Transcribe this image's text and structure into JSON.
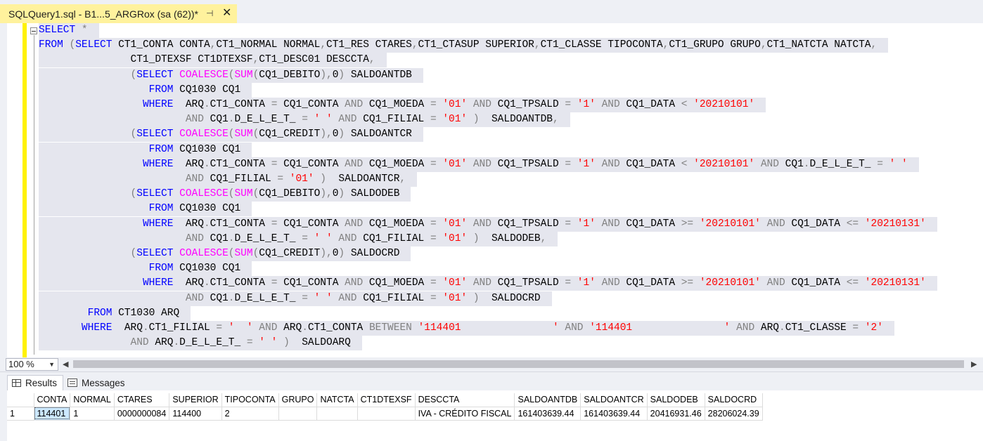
{
  "tab": {
    "title": "SQLQuery1.sql - B1...5_ARGRox (sa (62))*",
    "pin_icon": "pin-icon",
    "close_icon": "close-icon"
  },
  "editor": {
    "lines": [
      [
        [
          "kw",
          "SELECT"
        ],
        [
          "tx",
          " "
        ],
        [
          "op",
          "*"
        ]
      ],
      [
        [
          "kw",
          "FROM"
        ],
        [
          "tx",
          " "
        ],
        [
          "op",
          "("
        ],
        [
          "kw",
          "SELECT"
        ],
        [
          "tx",
          " CT1_CONTA CONTA"
        ],
        [
          "op",
          ","
        ],
        [
          "tx",
          "CT1_NORMAL NORMAL"
        ],
        [
          "op",
          ","
        ],
        [
          "tx",
          "CT1_RES CTARES"
        ],
        [
          "op",
          ","
        ],
        [
          "tx",
          "CT1_CTASUP SUPERIOR"
        ],
        [
          "op",
          ","
        ],
        [
          "tx",
          "CT1_CLASSE TIPOCONTA"
        ],
        [
          "op",
          ","
        ],
        [
          "tx",
          "CT1_GRUPO GRUPO"
        ],
        [
          "op",
          ","
        ],
        [
          "tx",
          "CT1_NATCTA NATCTA"
        ],
        [
          "op",
          ","
        ]
      ],
      [
        [
          "tx",
          "               CT1_DTEXSF CT1DTEXSF"
        ],
        [
          "op",
          ","
        ],
        [
          "tx",
          "CT1_DESC01 DESCCTA"
        ],
        [
          "op",
          ","
        ]
      ],
      [
        [
          "tx",
          "               "
        ],
        [
          "op",
          "("
        ],
        [
          "kw",
          "SELECT"
        ],
        [
          "tx",
          " "
        ],
        [
          "fn",
          "COALESCE"
        ],
        [
          "op",
          "("
        ],
        [
          "fn",
          "SUM"
        ],
        [
          "op",
          "("
        ],
        [
          "tx",
          "CQ1_DEBITO"
        ],
        [
          "op",
          "),"
        ],
        [
          "tx",
          "0"
        ],
        [
          "op",
          ")"
        ],
        [
          "tx",
          " SALDOANTDB"
        ]
      ],
      [
        [
          "tx",
          "                  "
        ],
        [
          "kw",
          "FROM"
        ],
        [
          "tx",
          " CQ1030 CQ1"
        ]
      ],
      [
        [
          "tx",
          "                 "
        ],
        [
          "kw",
          "WHERE"
        ],
        [
          "tx",
          "  ARQ"
        ],
        [
          "op",
          "."
        ],
        [
          "tx",
          "CT1_CONTA "
        ],
        [
          "op",
          "="
        ],
        [
          "tx",
          " CQ1_CONTA "
        ],
        [
          "op",
          "AND"
        ],
        [
          "tx",
          " CQ1_MOEDA "
        ],
        [
          "op",
          "="
        ],
        [
          "tx",
          " "
        ],
        [
          "str",
          "'01'"
        ],
        [
          "tx",
          " "
        ],
        [
          "op",
          "AND"
        ],
        [
          "tx",
          " CQ1_TPSALD "
        ],
        [
          "op",
          "="
        ],
        [
          "tx",
          " "
        ],
        [
          "str",
          "'1'"
        ],
        [
          "tx",
          " "
        ],
        [
          "op",
          "AND"
        ],
        [
          "tx",
          " CQ1_DATA "
        ],
        [
          "op",
          "<"
        ],
        [
          "tx",
          " "
        ],
        [
          "str",
          "'20210101'"
        ]
      ],
      [
        [
          "tx",
          "                        "
        ],
        [
          "op",
          "AND"
        ],
        [
          "tx",
          " CQ1"
        ],
        [
          "op",
          "."
        ],
        [
          "tx",
          "D_E_L_E_T_ "
        ],
        [
          "op",
          "="
        ],
        [
          "tx",
          " "
        ],
        [
          "str",
          "' '"
        ],
        [
          "tx",
          " "
        ],
        [
          "op",
          "AND"
        ],
        [
          "tx",
          " CQ1_FILIAL "
        ],
        [
          "op",
          "="
        ],
        [
          "tx",
          " "
        ],
        [
          "str",
          "'01'"
        ],
        [
          "tx",
          " "
        ],
        [
          "op",
          ")"
        ],
        [
          "tx",
          "  SALDOANTDB"
        ],
        [
          "op",
          ","
        ]
      ],
      [
        [
          "tx",
          "               "
        ],
        [
          "op",
          "("
        ],
        [
          "kw",
          "SELECT"
        ],
        [
          "tx",
          " "
        ],
        [
          "fn",
          "COALESCE"
        ],
        [
          "op",
          "("
        ],
        [
          "fn",
          "SUM"
        ],
        [
          "op",
          "("
        ],
        [
          "tx",
          "CQ1_CREDIT"
        ],
        [
          "op",
          "),"
        ],
        [
          "tx",
          "0"
        ],
        [
          "op",
          ")"
        ],
        [
          "tx",
          " SALDOANTCR"
        ]
      ],
      [
        [
          "tx",
          "                  "
        ],
        [
          "kw",
          "FROM"
        ],
        [
          "tx",
          " CQ1030 CQ1"
        ]
      ],
      [
        [
          "tx",
          "                 "
        ],
        [
          "kw",
          "WHERE"
        ],
        [
          "tx",
          "  ARQ"
        ],
        [
          "op",
          "."
        ],
        [
          "tx",
          "CT1_CONTA "
        ],
        [
          "op",
          "="
        ],
        [
          "tx",
          " CQ1_CONTA "
        ],
        [
          "op",
          "AND"
        ],
        [
          "tx",
          " CQ1_MOEDA "
        ],
        [
          "op",
          "="
        ],
        [
          "tx",
          " "
        ],
        [
          "str",
          "'01'"
        ],
        [
          "tx",
          " "
        ],
        [
          "op",
          "AND"
        ],
        [
          "tx",
          " CQ1_TPSALD "
        ],
        [
          "op",
          "="
        ],
        [
          "tx",
          " "
        ],
        [
          "str",
          "'1'"
        ],
        [
          "tx",
          " "
        ],
        [
          "op",
          "AND"
        ],
        [
          "tx",
          " CQ1_DATA "
        ],
        [
          "op",
          "<"
        ],
        [
          "tx",
          " "
        ],
        [
          "str",
          "'20210101'"
        ],
        [
          "tx",
          " "
        ],
        [
          "op",
          "AND"
        ],
        [
          "tx",
          " CQ1"
        ],
        [
          "op",
          "."
        ],
        [
          "tx",
          "D_E_L_E_T_ "
        ],
        [
          "op",
          "="
        ],
        [
          "tx",
          " "
        ],
        [
          "str",
          "' '"
        ]
      ],
      [
        [
          "tx",
          "                        "
        ],
        [
          "op",
          "AND"
        ],
        [
          "tx",
          " CQ1_FILIAL "
        ],
        [
          "op",
          "="
        ],
        [
          "tx",
          " "
        ],
        [
          "str",
          "'01'"
        ],
        [
          "tx",
          " "
        ],
        [
          "op",
          ")"
        ],
        [
          "tx",
          "  SALDOANTCR"
        ],
        [
          "op",
          ","
        ]
      ],
      [
        [
          "tx",
          "               "
        ],
        [
          "op",
          "("
        ],
        [
          "kw",
          "SELECT"
        ],
        [
          "tx",
          " "
        ],
        [
          "fn",
          "COALESCE"
        ],
        [
          "op",
          "("
        ],
        [
          "fn",
          "SUM"
        ],
        [
          "op",
          "("
        ],
        [
          "tx",
          "CQ1_DEBITO"
        ],
        [
          "op",
          "),"
        ],
        [
          "tx",
          "0"
        ],
        [
          "op",
          ")"
        ],
        [
          "tx",
          " SALDODEB"
        ]
      ],
      [
        [
          "tx",
          "                  "
        ],
        [
          "kw",
          "FROM"
        ],
        [
          "tx",
          " CQ1030 CQ1"
        ]
      ],
      [
        [
          "tx",
          "                 "
        ],
        [
          "kw",
          "WHERE"
        ],
        [
          "tx",
          "  ARQ"
        ],
        [
          "op",
          "."
        ],
        [
          "tx",
          "CT1_CONTA "
        ],
        [
          "op",
          "="
        ],
        [
          "tx",
          " CQ1_CONTA "
        ],
        [
          "op",
          "AND"
        ],
        [
          "tx",
          " CQ1_MOEDA "
        ],
        [
          "op",
          "="
        ],
        [
          "tx",
          " "
        ],
        [
          "str",
          "'01'"
        ],
        [
          "tx",
          " "
        ],
        [
          "op",
          "AND"
        ],
        [
          "tx",
          " CQ1_TPSALD "
        ],
        [
          "op",
          "="
        ],
        [
          "tx",
          " "
        ],
        [
          "str",
          "'1'"
        ],
        [
          "tx",
          " "
        ],
        [
          "op",
          "AND"
        ],
        [
          "tx",
          " CQ1_DATA "
        ],
        [
          "op",
          ">="
        ],
        [
          "tx",
          " "
        ],
        [
          "str",
          "'20210101'"
        ],
        [
          "tx",
          " "
        ],
        [
          "op",
          "AND"
        ],
        [
          "tx",
          " CQ1_DATA "
        ],
        [
          "op",
          "<="
        ],
        [
          "tx",
          " "
        ],
        [
          "str",
          "'20210131'"
        ]
      ],
      [
        [
          "tx",
          "                        "
        ],
        [
          "op",
          "AND"
        ],
        [
          "tx",
          " CQ1"
        ],
        [
          "op",
          "."
        ],
        [
          "tx",
          "D_E_L_E_T_ "
        ],
        [
          "op",
          "="
        ],
        [
          "tx",
          " "
        ],
        [
          "str",
          "' '"
        ],
        [
          "tx",
          " "
        ],
        [
          "op",
          "AND"
        ],
        [
          "tx",
          " CQ1_FILIAL "
        ],
        [
          "op",
          "="
        ],
        [
          "tx",
          " "
        ],
        [
          "str",
          "'01'"
        ],
        [
          "tx",
          " "
        ],
        [
          "op",
          ")"
        ],
        [
          "tx",
          "  SALDODEB"
        ],
        [
          "op",
          ","
        ]
      ],
      [
        [
          "tx",
          "               "
        ],
        [
          "op",
          "("
        ],
        [
          "kw",
          "SELECT"
        ],
        [
          "tx",
          " "
        ],
        [
          "fn",
          "COALESCE"
        ],
        [
          "op",
          "("
        ],
        [
          "fn",
          "SUM"
        ],
        [
          "op",
          "("
        ],
        [
          "tx",
          "CQ1_CREDIT"
        ],
        [
          "op",
          "),"
        ],
        [
          "tx",
          "0"
        ],
        [
          "op",
          ")"
        ],
        [
          "tx",
          " SALDOCRD"
        ]
      ],
      [
        [
          "tx",
          "                  "
        ],
        [
          "kw",
          "FROM"
        ],
        [
          "tx",
          " CQ1030 CQ1"
        ]
      ],
      [
        [
          "tx",
          "                 "
        ],
        [
          "kw",
          "WHERE"
        ],
        [
          "tx",
          "  ARQ"
        ],
        [
          "op",
          "."
        ],
        [
          "tx",
          "CT1_CONTA "
        ],
        [
          "op",
          "="
        ],
        [
          "tx",
          " CQ1_CONTA "
        ],
        [
          "op",
          "AND"
        ],
        [
          "tx",
          " CQ1_MOEDA "
        ],
        [
          "op",
          "="
        ],
        [
          "tx",
          " "
        ],
        [
          "str",
          "'01'"
        ],
        [
          "tx",
          " "
        ],
        [
          "op",
          "AND"
        ],
        [
          "tx",
          " CQ1_TPSALD "
        ],
        [
          "op",
          "="
        ],
        [
          "tx",
          " "
        ],
        [
          "str",
          "'1'"
        ],
        [
          "tx",
          " "
        ],
        [
          "op",
          "AND"
        ],
        [
          "tx",
          " CQ1_DATA "
        ],
        [
          "op",
          ">="
        ],
        [
          "tx",
          " "
        ],
        [
          "str",
          "'20210101'"
        ],
        [
          "tx",
          " "
        ],
        [
          "op",
          "AND"
        ],
        [
          "tx",
          " CQ1_DATA "
        ],
        [
          "op",
          "<="
        ],
        [
          "tx",
          " "
        ],
        [
          "str",
          "'20210131'"
        ]
      ],
      [
        [
          "tx",
          "                        "
        ],
        [
          "op",
          "AND"
        ],
        [
          "tx",
          " CQ1"
        ],
        [
          "op",
          "."
        ],
        [
          "tx",
          "D_E_L_E_T_ "
        ],
        [
          "op",
          "="
        ],
        [
          "tx",
          " "
        ],
        [
          "str",
          "' '"
        ],
        [
          "tx",
          " "
        ],
        [
          "op",
          "AND"
        ],
        [
          "tx",
          " CQ1_FILIAL "
        ],
        [
          "op",
          "="
        ],
        [
          "tx",
          " "
        ],
        [
          "str",
          "'01'"
        ],
        [
          "tx",
          " "
        ],
        [
          "op",
          ")"
        ],
        [
          "tx",
          "  SALDOCRD"
        ]
      ],
      [
        [
          "tx",
          "        "
        ],
        [
          "kw",
          "FROM"
        ],
        [
          "tx",
          " CT1030 ARQ"
        ]
      ],
      [
        [
          "tx",
          "       "
        ],
        [
          "kw",
          "WHERE"
        ],
        [
          "tx",
          "  ARQ"
        ],
        [
          "op",
          "."
        ],
        [
          "tx",
          "CT1_FILIAL "
        ],
        [
          "op",
          "="
        ],
        [
          "tx",
          " "
        ],
        [
          "str",
          "'  '"
        ],
        [
          "tx",
          " "
        ],
        [
          "op",
          "AND"
        ],
        [
          "tx",
          " ARQ"
        ],
        [
          "op",
          "."
        ],
        [
          "tx",
          "CT1_CONTA "
        ],
        [
          "op",
          "BETWEEN"
        ],
        [
          "tx",
          " "
        ],
        [
          "str",
          "'114401               '"
        ],
        [
          "tx",
          " "
        ],
        [
          "op",
          "AND"
        ],
        [
          "tx",
          " "
        ],
        [
          "str",
          "'114401               '"
        ],
        [
          "tx",
          " "
        ],
        [
          "op",
          "AND"
        ],
        [
          "tx",
          " ARQ"
        ],
        [
          "op",
          "."
        ],
        [
          "tx",
          "CT1_CLASSE "
        ],
        [
          "op",
          "="
        ],
        [
          "tx",
          " "
        ],
        [
          "str",
          "'2'"
        ]
      ],
      [
        [
          "tx",
          "               "
        ],
        [
          "op",
          "AND"
        ],
        [
          "tx",
          " ARQ"
        ],
        [
          "op",
          "."
        ],
        [
          "tx",
          "D_E_L_E_T_ "
        ],
        [
          "op",
          "="
        ],
        [
          "tx",
          " "
        ],
        [
          "str",
          "' '"
        ],
        [
          "tx",
          " "
        ],
        [
          "op",
          ")"
        ],
        [
          "tx",
          "  SALDOARQ"
        ]
      ]
    ]
  },
  "zoom": {
    "value": "100 %"
  },
  "results_tabs": {
    "results": "Results",
    "messages": "Messages"
  },
  "grid": {
    "columns": [
      "CONTA",
      "NORMAL",
      "CTARES",
      "SUPERIOR",
      "TIPOCONTA",
      "GRUPO",
      "NATCTA",
      "CT1DTEXSF",
      "DESCCTA",
      "SALDOANTDB",
      "SALDOANTCR",
      "SALDODEB",
      "SALDOCRD"
    ],
    "rows": [
      [
        "1",
        "114401",
        "1",
        "0000000084",
        "114400",
        "2",
        "",
        "",
        "",
        "IVA - CRÉDITO FISCAL",
        "161403639.44",
        "161403639.44",
        "20416931.46",
        "28206024.39"
      ]
    ]
  },
  "colors": {
    "keyword": "#0000ff",
    "function": "#ff00ff",
    "operator": "#808080",
    "string": "#ff0000",
    "tab_active": "#fff29d",
    "change_bar": "#fff200",
    "selection": "#cce8ff"
  }
}
